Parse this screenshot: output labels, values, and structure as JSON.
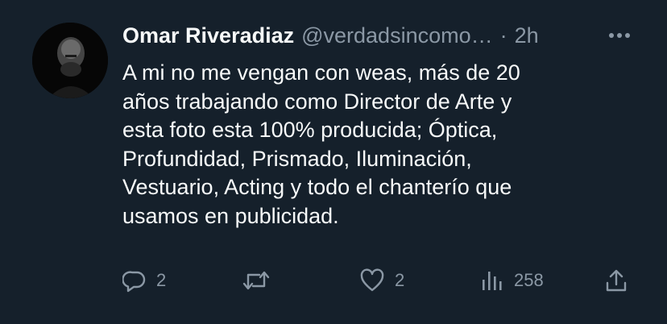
{
  "tweet": {
    "author_name": "Omar Riveradiaz",
    "handle": "@verdadsincomo…",
    "separator": "·",
    "time": "2h",
    "text": "A mi no me vengan con weas, más de 20\naños trabajando como Director de Arte y\nesta foto esta 100% producida; Óptica,\nProfundidad, Prismado, Iluminación,\nVestuario, Acting y todo el chanterío que\nusamos en publicidad."
  },
  "actions": {
    "reply_count": "2",
    "retweet_count": "",
    "like_count": "2",
    "views_count": "258"
  },
  "icons": {
    "more": "more-icon",
    "reply": "reply-icon",
    "retweet": "retweet-icon",
    "like": "heart-icon",
    "views": "views-icon",
    "share": "share-icon"
  },
  "colors": {
    "background": "#15202b",
    "primary_text": "#f7f9f9",
    "secondary_text": "#8b98a5"
  }
}
